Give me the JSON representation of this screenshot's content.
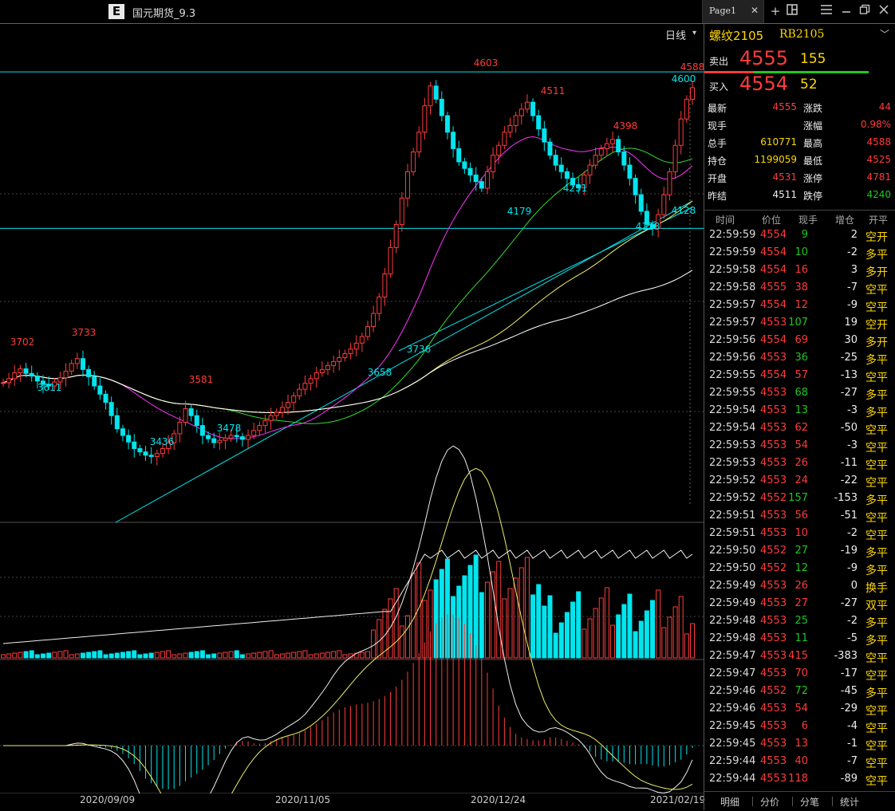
{
  "window": {
    "app_logo_letter": "E",
    "title": "国元期货_9.3",
    "tab_label": "Page1",
    "tab_close": "✕",
    "toolbar_icons": [
      "plus-icon",
      "layout-icon",
      "menu-icon",
      "minimize-icon",
      "restore-icon",
      "close-icon"
    ]
  },
  "chart": {
    "period_label": "日线",
    "date_labels": [
      "2020/09/09",
      "2020/11/05",
      "2020/12/24",
      "2021/02/19"
    ],
    "price_annotations_high": [
      "3702",
      "3733",
      "3581",
      "4603",
      "4511",
      "4398",
      "4588",
      "4600"
    ],
    "price_annotations_low": [
      "3611",
      "3436",
      "3478",
      "3658",
      "3736",
      "4179",
      "4251",
      "4128",
      "4128"
    ]
  },
  "chart_data": {
    "type": "candlestick",
    "symbol": "RB2105",
    "period": "日线",
    "x_labels": [
      "2020/09/09",
      "2020/11/05",
      "2020/12/24",
      "2021/02/19"
    ],
    "marked_highs": [
      3702,
      3733,
      3581,
      4603,
      4511,
      4398,
      4588,
      4600
    ],
    "marked_lows": [
      3611,
      3436,
      3478,
      3658,
      3736,
      4179,
      4251,
      4128,
      4128
    ],
    "reference_lines": [
      4603,
      4128
    ],
    "closes": [
      3660,
      3672,
      3690,
      3702,
      3688,
      3680,
      3665,
      3655,
      3650,
      3662,
      3675,
      3695,
      3718,
      3733,
      3700,
      3678,
      3650,
      3625,
      3600,
      3560,
      3520,
      3500,
      3480,
      3460,
      3450,
      3440,
      3436,
      3445,
      3460,
      3478,
      3505,
      3540,
      3581,
      3560,
      3530,
      3500,
      3490,
      3478,
      3485,
      3492,
      3500,
      3496,
      3488,
      3500,
      3515,
      3530,
      3545,
      3560,
      3570,
      3585,
      3600,
      3620,
      3640,
      3658,
      3672,
      3690,
      3700,
      3712,
      3724,
      3736,
      3748,
      3762,
      3780,
      3800,
      3830,
      3870,
      3920,
      3990,
      4070,
      4140,
      4220,
      4300,
      4360,
      4420,
      4500,
      4560,
      4520,
      4470,
      4420,
      4370,
      4330,
      4310,
      4290,
      4270,
      4250,
      4300,
      4350,
      4380,
      4420,
      4440,
      4470,
      4490,
      4511,
      4470,
      4430,
      4390,
      4350,
      4320,
      4300,
      4280,
      4260,
      4251,
      4290,
      4320,
      4350,
      4370,
      4385,
      4398,
      4360,
      4320,
      4280,
      4230,
      4180,
      4140,
      4128,
      4170,
      4230,
      4300,
      4380,
      4460,
      4520,
      4555
    ]
  },
  "quote": {
    "name": "螺纹2105",
    "code": "RB2105",
    "ask_label": "卖出",
    "ask_price": "4555",
    "ask_vol": "155",
    "bid_label": "买入",
    "bid_price": "4554",
    "bid_vol": "52",
    "stats": [
      {
        "k1": "最新",
        "v1": "4555",
        "c1": "#ff3b3b",
        "k2": "涨跌",
        "v2": "44",
        "c2": "#ff3b3b"
      },
      {
        "k1": "现手",
        "v1": "",
        "c1": "#ff3b3b",
        "k2": "涨幅",
        "v2": "0.98%",
        "c2": "#ff3b3b"
      },
      {
        "k1": "总手",
        "v1": "610771",
        "c1": "#ffd700",
        "k2": "最高",
        "v2": "4588",
        "c2": "#ff3b3b"
      },
      {
        "k1": "持仓",
        "v1": "1199059",
        "c1": "#ffd700",
        "k2": "最低",
        "v2": "4525",
        "c2": "#ff3b3b"
      },
      {
        "k1": "开盘",
        "v1": "4531",
        "c1": "#ff3b3b",
        "k2": "涨停",
        "v2": "4781",
        "c2": "#ff3b3b"
      },
      {
        "k1": "昨结",
        "v1": "4511",
        "c1": "#eeeeee",
        "k2": "跌停",
        "v2": "4240",
        "c2": "#1ec71e"
      }
    ]
  },
  "ticks": {
    "headers": [
      "时间",
      "价位",
      "现手",
      "增仓",
      "开平"
    ],
    "rows": [
      {
        "time": "22:59:59",
        "price": "4554",
        "pc": "#ff3b3b",
        "vol": "9",
        "vc": "#1ec71e",
        "oi": "2",
        "type": "空开"
      },
      {
        "time": "22:59:59",
        "price": "4554",
        "pc": "#ff3b3b",
        "vol": "10",
        "vc": "#1ec71e",
        "oi": "-2",
        "type": "多平"
      },
      {
        "time": "22:59:58",
        "price": "4554",
        "pc": "#ff3b3b",
        "vol": "16",
        "vc": "#ff3b3b",
        "oi": "3",
        "type": "多开"
      },
      {
        "time": "22:59:58",
        "price": "4555",
        "pc": "#ff3b3b",
        "vol": "38",
        "vc": "#ff3b3b",
        "oi": "-7",
        "type": "空平"
      },
      {
        "time": "22:59:57",
        "price": "4554",
        "pc": "#ff3b3b",
        "vol": "12",
        "vc": "#ff3b3b",
        "oi": "-9",
        "type": "空平"
      },
      {
        "time": "22:59:57",
        "price": "4553",
        "pc": "#ff3b3b",
        "vol": "107",
        "vc": "#1ec71e",
        "oi": "19",
        "type": "空开"
      },
      {
        "time": "22:59:56",
        "price": "4554",
        "pc": "#ff3b3b",
        "vol": "69",
        "vc": "#ff3b3b",
        "oi": "30",
        "type": "多开"
      },
      {
        "time": "22:59:56",
        "price": "4553",
        "pc": "#ff3b3b",
        "vol": "36",
        "vc": "#1ec71e",
        "oi": "-25",
        "type": "多平"
      },
      {
        "time": "22:59:55",
        "price": "4554",
        "pc": "#ff3b3b",
        "vol": "57",
        "vc": "#ff3b3b",
        "oi": "-13",
        "type": "空平"
      },
      {
        "time": "22:59:55",
        "price": "4553",
        "pc": "#ff3b3b",
        "vol": "68",
        "vc": "#1ec71e",
        "oi": "-27",
        "type": "多平"
      },
      {
        "time": "22:59:54",
        "price": "4553",
        "pc": "#ff3b3b",
        "vol": "13",
        "vc": "#1ec71e",
        "oi": "-3",
        "type": "多平"
      },
      {
        "time": "22:59:54",
        "price": "4553",
        "pc": "#ff3b3b",
        "vol": "62",
        "vc": "#ff3b3b",
        "oi": "-50",
        "type": "空平"
      },
      {
        "time": "22:59:53",
        "price": "4553",
        "pc": "#ff3b3b",
        "vol": "54",
        "vc": "#ff3b3b",
        "oi": "-3",
        "type": "空平"
      },
      {
        "time": "22:59:53",
        "price": "4553",
        "pc": "#ff3b3b",
        "vol": "26",
        "vc": "#ff3b3b",
        "oi": "-11",
        "type": "空平"
      },
      {
        "time": "22:59:52",
        "price": "4553",
        "pc": "#ff3b3b",
        "vol": "24",
        "vc": "#ff3b3b",
        "oi": "-22",
        "type": "空平"
      },
      {
        "time": "22:59:52",
        "price": "4552",
        "pc": "#ff3b3b",
        "vol": "157",
        "vc": "#1ec71e",
        "oi": "-153",
        "type": "多平"
      },
      {
        "time": "22:59:51",
        "price": "4553",
        "pc": "#ff3b3b",
        "vol": "56",
        "vc": "#ff3b3b",
        "oi": "-51",
        "type": "空平"
      },
      {
        "time": "22:59:51",
        "price": "4553",
        "pc": "#ff3b3b",
        "vol": "10",
        "vc": "#ff3b3b",
        "oi": "-2",
        "type": "空平"
      },
      {
        "time": "22:59:50",
        "price": "4552",
        "pc": "#ff3b3b",
        "vol": "27",
        "vc": "#1ec71e",
        "oi": "-19",
        "type": "多平"
      },
      {
        "time": "22:59:50",
        "price": "4552",
        "pc": "#ff3b3b",
        "vol": "12",
        "vc": "#1ec71e",
        "oi": "-9",
        "type": "多平"
      },
      {
        "time": "22:59:49",
        "price": "4553",
        "pc": "#ff3b3b",
        "vol": "26",
        "vc": "#ff3b3b",
        "oi": "0",
        "type": "换手"
      },
      {
        "time": "22:59:49",
        "price": "4553",
        "pc": "#ff3b3b",
        "vol": "27",
        "vc": "#ff3b3b",
        "oi": "-27",
        "type": "双平"
      },
      {
        "time": "22:59:48",
        "price": "4553",
        "pc": "#ff3b3b",
        "vol": "25",
        "vc": "#1ec71e",
        "oi": "-2",
        "type": "多平"
      },
      {
        "time": "22:59:48",
        "price": "4553",
        "pc": "#ff3b3b",
        "vol": "11",
        "vc": "#1ec71e",
        "oi": "-5",
        "type": "多平"
      },
      {
        "time": "22:59:47",
        "price": "4553",
        "pc": "#ff3b3b",
        "vol": "415",
        "vc": "#ff3b3b",
        "oi": "-383",
        "type": "空平"
      },
      {
        "time": "22:59:47",
        "price": "4553",
        "pc": "#ff3b3b",
        "vol": "70",
        "vc": "#ff3b3b",
        "oi": "-17",
        "type": "空平"
      },
      {
        "time": "22:59:46",
        "price": "4552",
        "pc": "#ff3b3b",
        "vol": "72",
        "vc": "#1ec71e",
        "oi": "-45",
        "type": "多平"
      },
      {
        "time": "22:59:46",
        "price": "4553",
        "pc": "#ff3b3b",
        "vol": "54",
        "vc": "#ff3b3b",
        "oi": "-29",
        "type": "空平"
      },
      {
        "time": "22:59:45",
        "price": "4553",
        "pc": "#ff3b3b",
        "vol": "6",
        "vc": "#ff3b3b",
        "oi": "-4",
        "type": "空平"
      },
      {
        "time": "22:59:45",
        "price": "4553",
        "pc": "#ff3b3b",
        "vol": "13",
        "vc": "#ff3b3b",
        "oi": "-1",
        "type": "空平"
      },
      {
        "time": "22:59:44",
        "price": "4553",
        "pc": "#ff3b3b",
        "vol": "40",
        "vc": "#ff3b3b",
        "oi": "-7",
        "type": "空平"
      },
      {
        "time": "22:59:44",
        "price": "4553",
        "pc": "#ff3b3b",
        "vol": "118",
        "vc": "#ff3b3b",
        "oi": "-89",
        "type": "空平"
      }
    ]
  },
  "bottom_tabs": [
    "明细",
    "分价",
    "分笔",
    "统计"
  ],
  "colors": {
    "up": "#ff3b3b",
    "down": "#00e5ee",
    "ma1": "#ff33ff",
    "ma2": "#33dd33",
    "ma3": "#eeee66",
    "ma4": "#ffffff",
    "line": "#00e5ee"
  }
}
